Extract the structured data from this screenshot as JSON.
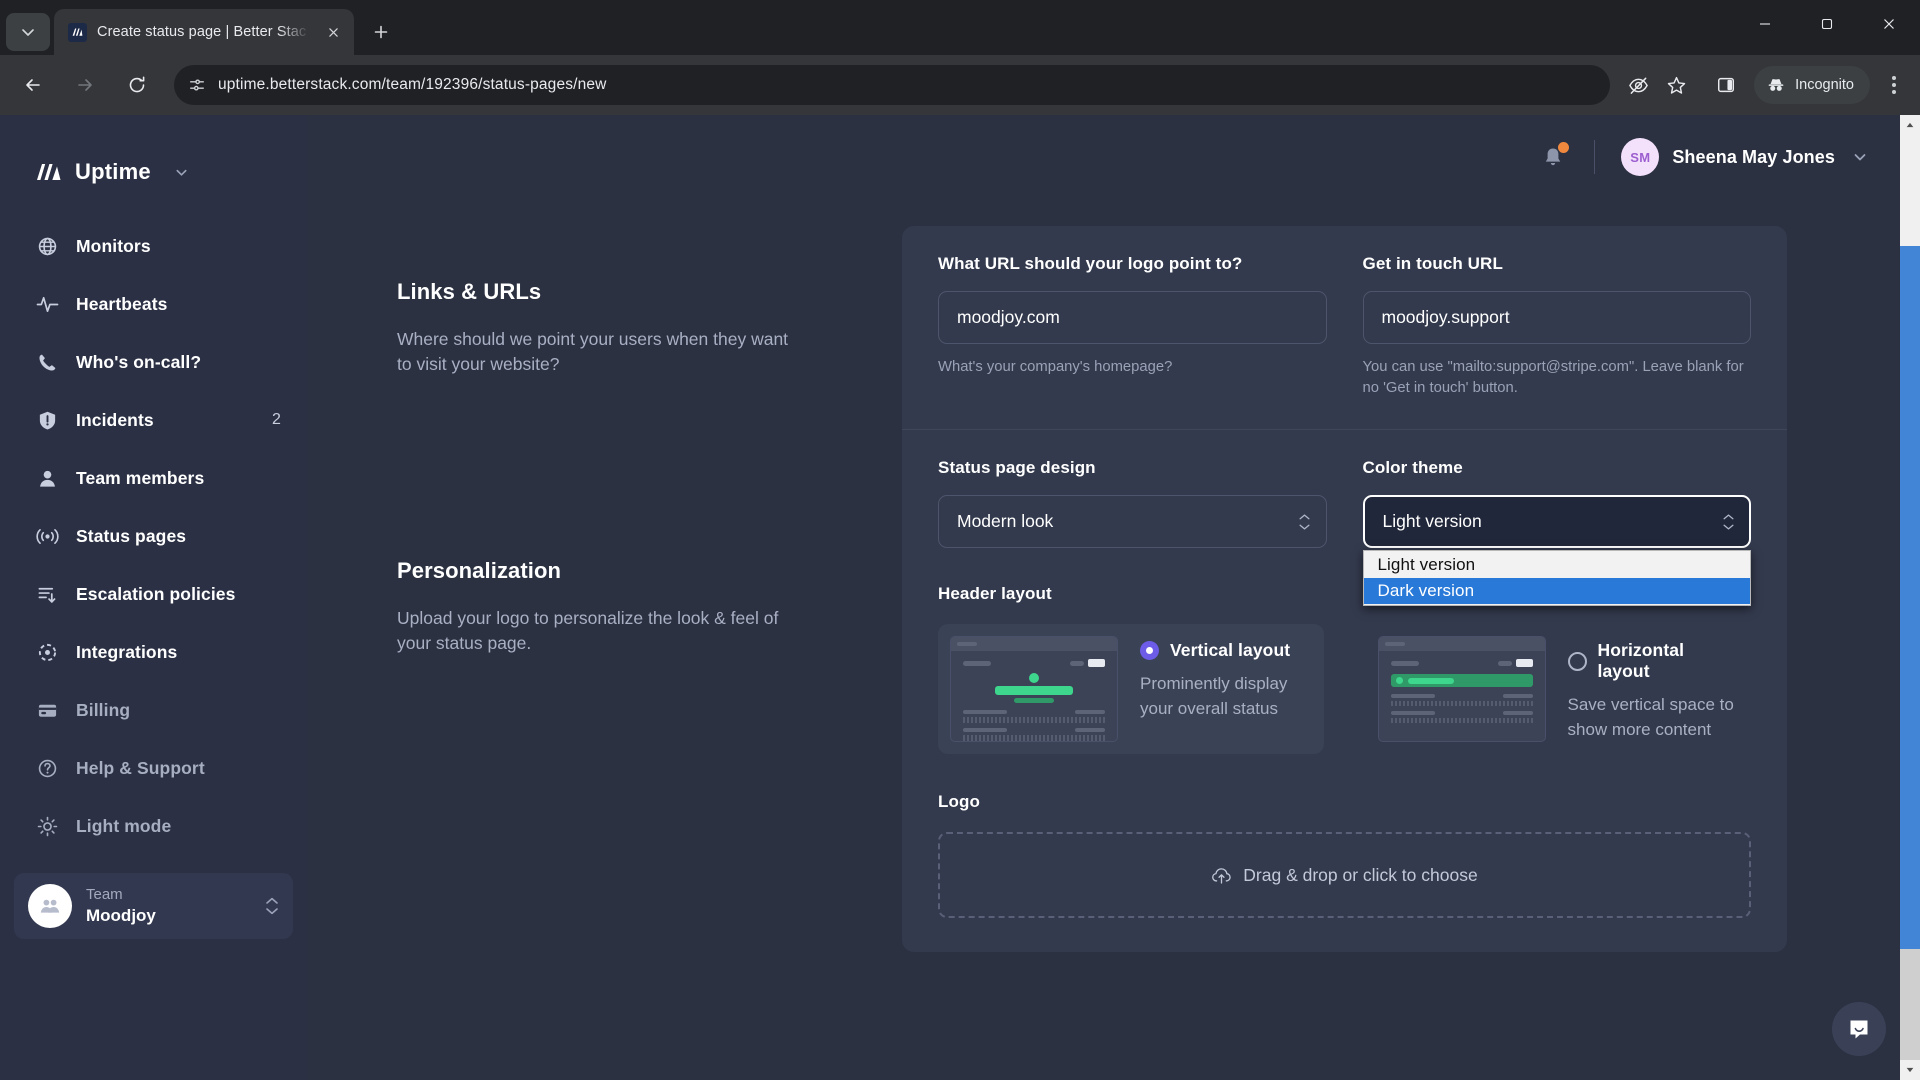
{
  "browser": {
    "tab": {
      "title": "Create status page | Better Stac",
      "favicon_name": "betterstack-favicon"
    },
    "newtab_label": "+",
    "url": "uptime.betterstack.com/team/192396/status-pages/new",
    "incognito_label": "Incognito",
    "window_controls": {
      "minimize": "—",
      "maximize": "▢",
      "close": "✕"
    }
  },
  "sidebar": {
    "brand": "Uptime",
    "items": [
      {
        "label": "Monitors",
        "icon": "globe-icon",
        "badge": ""
      },
      {
        "label": "Heartbeats",
        "icon": "pulse-icon",
        "badge": ""
      },
      {
        "label": "Who's on-call?",
        "icon": "phone-icon",
        "badge": ""
      },
      {
        "label": "Incidents",
        "icon": "shield-alert-icon",
        "badge": "2"
      },
      {
        "label": "Team members",
        "icon": "user-icon",
        "badge": ""
      },
      {
        "label": "Status pages",
        "icon": "broadcast-icon",
        "badge": ""
      },
      {
        "label": "Escalation policies",
        "icon": "escalation-icon",
        "badge": ""
      },
      {
        "label": "Integrations",
        "icon": "integrations-icon",
        "badge": ""
      }
    ],
    "bottom_items": [
      {
        "label": "Billing",
        "icon": "credit-card-icon"
      },
      {
        "label": "Help & Support",
        "icon": "question-circle-icon"
      },
      {
        "label": "Light mode",
        "icon": "sun-icon"
      }
    ],
    "team": {
      "label": "Team",
      "name": "Moodjoy",
      "avatar_icon": "team-avatar-icon"
    }
  },
  "header": {
    "notifications_icon": "bell-icon",
    "user": {
      "initials": "SM",
      "name": "Sheena May Jones"
    }
  },
  "left_sections": [
    {
      "title": "Links & URLs",
      "desc": "Where should we point your users when they want to visit your website?"
    },
    {
      "title": "Personalization",
      "desc": "Upload your logo to personalize the look & feel of your status page."
    }
  ],
  "form": {
    "logo_url": {
      "label": "What URL should your logo point to?",
      "value": "moodjoy.com",
      "placeholder": "",
      "help": "What's your company's homepage?"
    },
    "get_in_touch": {
      "label": "Get in touch URL",
      "value": "moodjoy.support",
      "placeholder": "",
      "help": "You can use \"mailto:support@stripe.com\". Leave blank for no 'Get in touch' button."
    },
    "design": {
      "label": "Status page design",
      "value": "Modern look",
      "options": [
        "Modern look"
      ]
    },
    "color_theme": {
      "label": "Color theme",
      "value": "Light version",
      "options": [
        "Light version",
        "Dark version"
      ],
      "highlighted_option": "Dark version",
      "open": true,
      "highlight_color": "#2979d8"
    },
    "header_layout": {
      "label": "Header layout",
      "options": [
        {
          "title": "Vertical layout",
          "desc": "Prominently display your overall status",
          "selected": true,
          "thumb": "vertical-layout-preview"
        },
        {
          "title": "Horizontal layout",
          "desc": "Save vertical space to show more content",
          "selected": false,
          "thumb": "horizontal-layout-preview"
        }
      ]
    },
    "logo": {
      "label": "Logo",
      "dropzone_text": "Drag & drop or click to choose",
      "dropzone_icon": "upload-cloud-icon"
    }
  },
  "widgets": {
    "intercom_icon": "chat-bubble-icon"
  },
  "colors": {
    "sidebar_bg": "#2b3044",
    "page_bg": "#2b3140",
    "card_bg": "#333a4d",
    "accent_purple": "#6c5ce7",
    "accent_green": "#3dd68c",
    "select_highlight": "#2979d8"
  }
}
